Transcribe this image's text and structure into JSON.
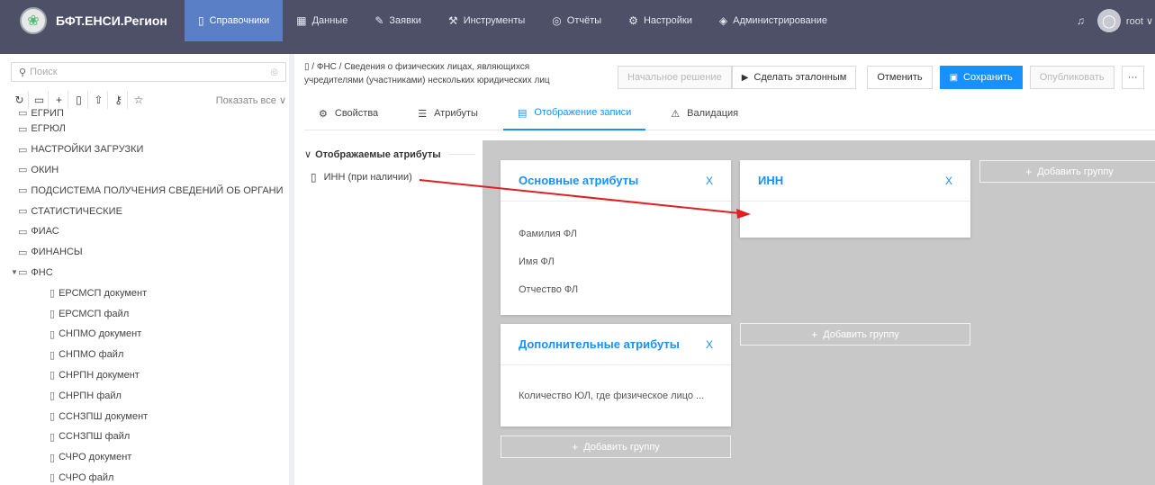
{
  "app": {
    "name": "БФТ.ЕНСИ.Регион"
  },
  "nav": [
    {
      "label": "Справочники",
      "icon": "book-icon",
      "glyph": "▯",
      "active": true
    },
    {
      "label": "Данные",
      "icon": "table-icon",
      "glyph": "▦"
    },
    {
      "label": "Заявки",
      "icon": "edit-icon",
      "glyph": "✎"
    },
    {
      "label": "Инструменты",
      "icon": "tools-icon",
      "glyph": "⚒"
    },
    {
      "label": "Отчёты",
      "icon": "reports-icon",
      "glyph": "◎"
    },
    {
      "label": "Настройки",
      "icon": "settings-icon",
      "glyph": "⚙"
    },
    {
      "label": "Администрирование",
      "icon": "shield-icon",
      "glyph": "◈"
    }
  ],
  "user": {
    "name": "root"
  },
  "sidebar": {
    "search_placeholder": "Поиск",
    "show_all": "Показать все ∨",
    "tree": [
      {
        "label": "ЕГРЮЛ"
      },
      {
        "label": "НАСТРОЙКИ ЗАГРУЗКИ"
      },
      {
        "label": "ОКИН"
      },
      {
        "label": "ПОДСИСТЕМА ПОЛУЧЕНИЯ СВЕДЕНИЙ ОБ ОРГАНИ"
      },
      {
        "label": "СТАТИСТИЧЕСКИЕ"
      },
      {
        "label": "ФИАС"
      },
      {
        "label": "ФИНАНСЫ"
      },
      {
        "label": "ФНС"
      }
    ],
    "children": [
      "ЕРСМСП документ",
      "ЕРСМСП файл",
      "СНПМО документ",
      "СНПМО файл",
      "СНРПН документ",
      "СНРПН файл",
      "ССНЗПШ документ",
      "ССНЗПШ файл",
      "СЧРО документ",
      "СЧРО файл"
    ]
  },
  "breadcrumb": {
    "line1": "▯ / ФНС / Сведения о физических лицах, являющихся",
    "line2": "учредителями (участниками) нескольких юридических лиц"
  },
  "actions": {
    "initial": "Начальное решение",
    "make_reference": "Сделать эталонным",
    "cancel": "Отменить",
    "save": "Сохранить",
    "publish": "Опубликовать",
    "more": "···"
  },
  "tabs": [
    {
      "label": "Свойства",
      "icon": "gear-icon",
      "glyph": "⚙"
    },
    {
      "label": "Атрибуты",
      "icon": "list-icon",
      "glyph": "☰"
    },
    {
      "label": "Отображение записи",
      "icon": "layout-icon",
      "glyph": "▤",
      "active": true
    },
    {
      "label": "Валидация",
      "icon": "warning-icon",
      "glyph": "⚠"
    }
  ],
  "attributes": {
    "heading": "Отображаемые атрибуты",
    "items": [
      "ИНН (при наличии)"
    ]
  },
  "groups": {
    "main": {
      "title": "Основные атрибуты",
      "rows": [
        "Фамилия ФЛ",
        "Имя ФЛ",
        "Отчество ФЛ"
      ]
    },
    "inn": {
      "title": "ИНН",
      "rows": []
    },
    "extra": {
      "title": "Дополнительные атрибуты",
      "rows": [
        "Количество ЮЛ, где физическое лицо ..."
      ]
    },
    "add_group": "Добавить группу"
  },
  "colors": {
    "topbar": "#4e5068",
    "accent": "#1890ff",
    "active_nav": "#5b7fc6",
    "canvas": "#c8c8c8",
    "arrow": "#e02020"
  }
}
